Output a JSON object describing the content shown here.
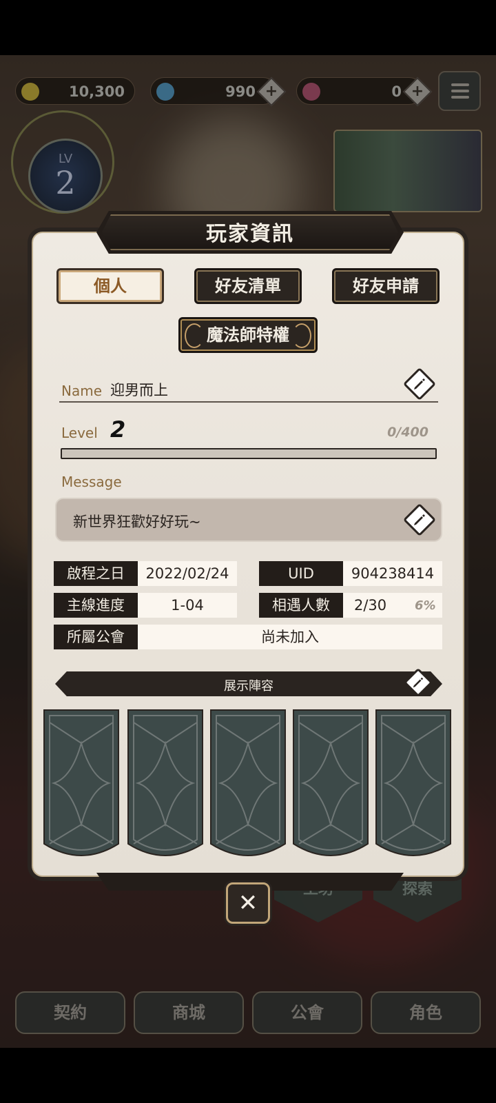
{
  "hud": {
    "gold": "10,300",
    "gems": "990",
    "pink_gems": "0",
    "level_label": "LV",
    "level": "2"
  },
  "bottom_nav": [
    "契約",
    "商城",
    "公會",
    "角色"
  ],
  "side_tiles": [
    "工坊",
    "探索"
  ],
  "dialog": {
    "title": "玩家資訊",
    "tabs": {
      "personal": "個人",
      "friend_list": "好友清單",
      "friend_requests": "好友申請",
      "privilege": "魔法師特權"
    },
    "name_label": "Name",
    "name_value": "迎男而上",
    "level_label": "Level",
    "level_value": "2",
    "xp_text": "0/400",
    "xp_progress": 0,
    "message_label": "Message",
    "message_value": "新世界狂歡好好玩~",
    "info": {
      "start_date_label": "啟程之日",
      "start_date_value": "2022/02/24",
      "uid_label": "UID",
      "uid_value": "904238414",
      "story_label": "主線進度",
      "story_value": "1-04",
      "encounter_label": "相遇人數",
      "encounter_value": "2/30",
      "encounter_pct": "6%",
      "guild_label": "所屬公會",
      "guild_value": "尚未加入"
    },
    "lineup_label": "展示陣容",
    "close": "✕"
  },
  "colors": {
    "panel_dark": "#231d19",
    "panel_light": "#efeae2",
    "accent_gold": "#c9a77a",
    "label_brown": "#8a6a3e",
    "card_slot": "#3d4a49"
  }
}
